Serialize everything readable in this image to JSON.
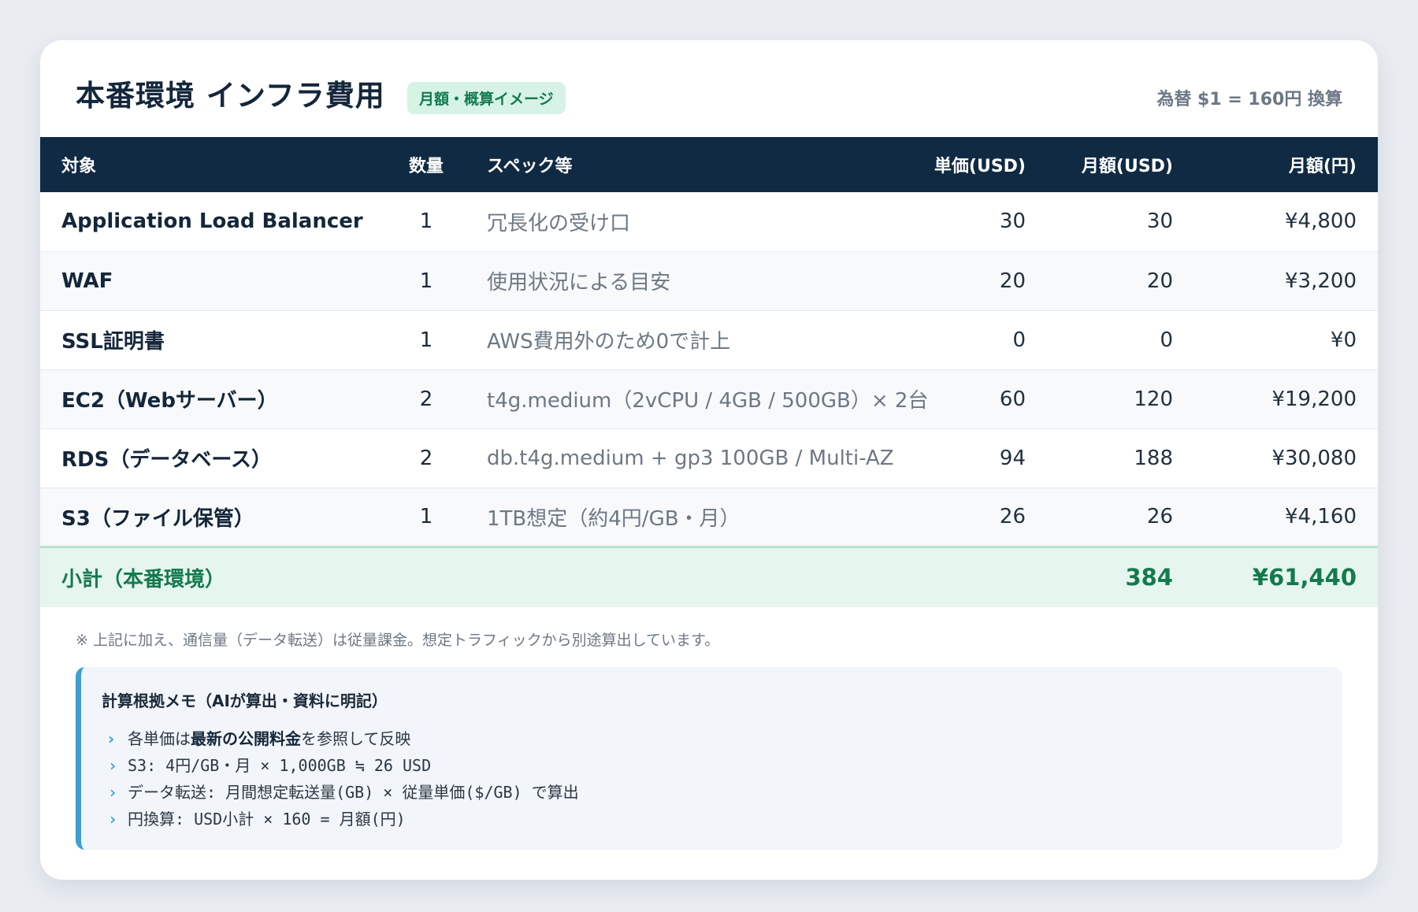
{
  "header": {
    "title": "本番環境 インフラ費用",
    "badge": "月額・概算イメージ",
    "exchange_rate": "為替 $1 = 160円 換算"
  },
  "table": {
    "columns": [
      "対象",
      "数量",
      "スペック等",
      "単価(USD)",
      "月額(USD)",
      "月額(円)"
    ],
    "rows": [
      {
        "item": "Application Load Balancer",
        "qty": "1",
        "spec": "冗長化の受け口",
        "unit_usd": "30",
        "monthly_usd": "30",
        "monthly_jpy": "¥4,800"
      },
      {
        "item": "WAF",
        "qty": "1",
        "spec": "使用状況による目安",
        "unit_usd": "20",
        "monthly_usd": "20",
        "monthly_jpy": "¥3,200"
      },
      {
        "item": "SSL証明書",
        "qty": "1",
        "spec": "AWS費用外のため0で計上",
        "unit_usd": "0",
        "monthly_usd": "0",
        "monthly_jpy": "¥0"
      },
      {
        "item": "EC2（Webサーバー）",
        "qty": "2",
        "spec": "t4g.medium（2vCPU / 4GB / 500GB）× 2台",
        "unit_usd": "60",
        "monthly_usd": "120",
        "monthly_jpy": "¥19,200"
      },
      {
        "item": "RDS（データベース）",
        "qty": "2",
        "spec": "db.t4g.medium + gp3 100GB / Multi-AZ",
        "unit_usd": "94",
        "monthly_usd": "188",
        "monthly_jpy": "¥30,080"
      },
      {
        "item": "S3（ファイル保管）",
        "qty": "1",
        "spec": "1TB想定（約4円/GB・月）",
        "unit_usd": "26",
        "monthly_usd": "26",
        "monthly_jpy": "¥4,160"
      }
    ],
    "subtotal": {
      "label": "小計（本番環境）",
      "monthly_usd": "384",
      "monthly_jpy": "¥61,440"
    }
  },
  "note": "※ 上記に加え、通信量（データ転送）は従量課金。想定トラフィックから別途算出しています。",
  "memo": {
    "title": "計算根拠メモ（AIが算出・資料に明記）",
    "line1_prefix": "各単価は",
    "line1_bold": "最新の公開料金",
    "line1_suffix": "を参照して反映",
    "line2": "S3: 4円/GB・月 × 1,000GB ≒ 26 USD",
    "line3": "データ転送: 月間想定転送量(GB) × 従量単価($/GB) で算出",
    "line4": "円換算: USD小計 × 160 = 月額(円)",
    "bullet_icon": "chevron-right-icon",
    "accent_color": "#3aa0d8"
  },
  "colors": {
    "header_bg": "#102a43",
    "subtotal_bg": "#e6f5ee",
    "subtotal_text": "#137a4e"
  }
}
